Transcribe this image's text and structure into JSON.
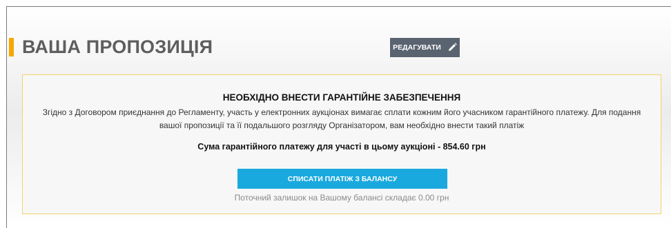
{
  "section": {
    "title": "ВАША ПРОПОЗИЦІЯ",
    "edit_label": "РЕДАГУВАТИ",
    "edit_icon": "pencil-icon",
    "accent_color": "#f6a800"
  },
  "notice": {
    "title": "НЕОБХІДНО ВНЕСТИ ГАРАНТІЙНЕ ЗАБЕЗПЕЧЕННЯ",
    "text": "Згідно з Договором приєднання до Регламенту, участь у електронних аукціонах вимагає сплати кожним його учасником гарантійного платежу. Для подання вашої пропозиції та її подальшого розгляду Організатором, вам необхідно внести такий платіж",
    "sum_text": "Сума гарантійного платежу для участі в цьому аукціоні - 854.60 грн",
    "pay_button_label": "СПИСАТИ ПЛАТІЖ З БАЛАНСУ",
    "balance_text": "Поточний залишок на Вашому балансі складає 0.00 грн",
    "border_color": "#f3d36a",
    "button_color": "#1aa9de"
  }
}
